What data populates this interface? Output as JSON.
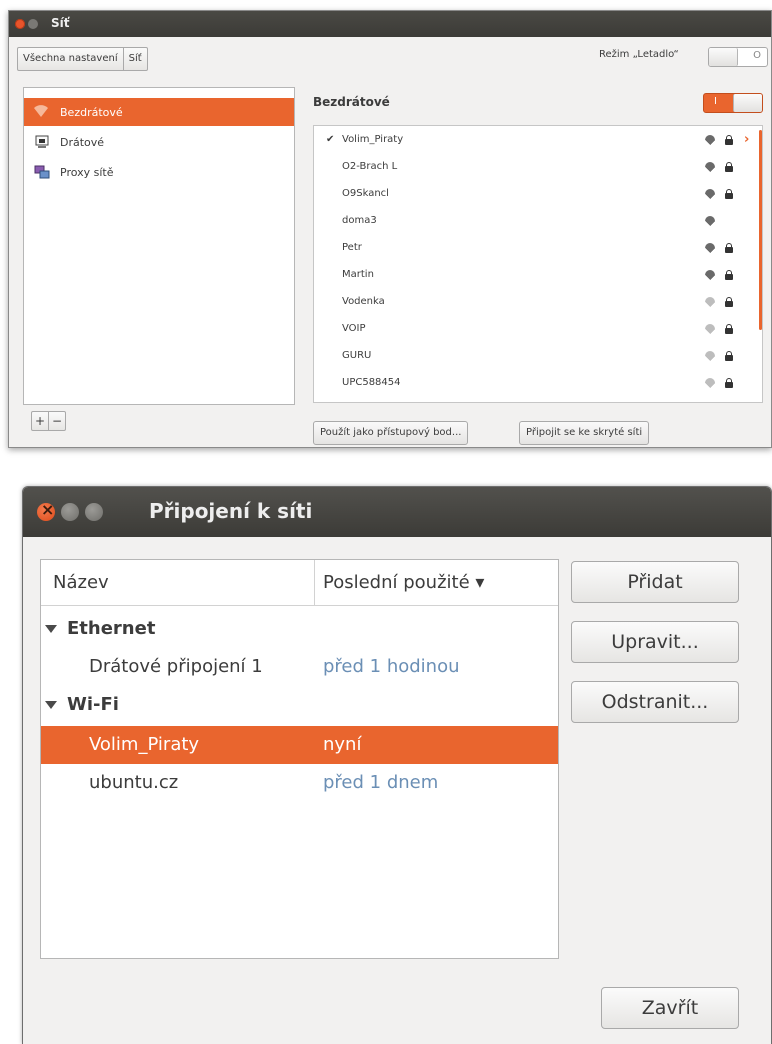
{
  "window_network": {
    "title": "Síť",
    "breadcrumb": [
      "Všechna nastavení",
      "Síť"
    ],
    "airplane_mode_label": "Režim „Letadlo“",
    "airplane_toggle_state": "O",
    "devices": [
      {
        "label": "Bezdrátové",
        "icon": "wifi-icon",
        "selected": true
      },
      {
        "label": "Drátové",
        "icon": "ethernet-icon",
        "selected": false
      },
      {
        "label": "Proxy sítě",
        "icon": "proxy-icon",
        "selected": false
      }
    ],
    "add_label": "+",
    "remove_label": "−",
    "section_title": "Bezdrátové",
    "wireless_toggle_state": "I",
    "networks": [
      {
        "name": "Volim_Piraty",
        "connected": true,
        "check": "✔",
        "locked": true,
        "signal": "strong"
      },
      {
        "name": "O2-Brach L",
        "connected": false,
        "check": "",
        "locked": true,
        "signal": "strong"
      },
      {
        "name": "O9Skancl",
        "connected": false,
        "check": "",
        "locked": true,
        "signal": "strong"
      },
      {
        "name": "doma3",
        "connected": false,
        "check": "",
        "locked": false,
        "signal": "strong"
      },
      {
        "name": "Petr",
        "connected": false,
        "check": "",
        "locked": true,
        "signal": "strong"
      },
      {
        "name": "Martin",
        "connected": false,
        "check": "",
        "locked": true,
        "signal": "strong"
      },
      {
        "name": "Vodenka",
        "connected": false,
        "check": "",
        "locked": true,
        "signal": "weak"
      },
      {
        "name": "VOIP",
        "connected": false,
        "check": "",
        "locked": true,
        "signal": "weak"
      },
      {
        "name": "GURU",
        "connected": false,
        "check": "",
        "locked": true,
        "signal": "weak"
      },
      {
        "name": "UPC588454",
        "connected": false,
        "check": "",
        "locked": true,
        "signal": "weak"
      }
    ],
    "detail_arrow": "›",
    "hotspot_button": "Použít jako přístupový bod...",
    "hidden_button": "Připojit se ke skryté síti",
    "accent_color": "#e9652e"
  },
  "window_connections": {
    "title": "Připojení k síti",
    "columns": {
      "name": "Název",
      "last_used": "Poslední použité ▾"
    },
    "groups": [
      {
        "label": "Ethernet",
        "items": [
          {
            "name": "Drátové připojení 1",
            "last_used": "před 1 hodinou",
            "selected": false
          }
        ]
      },
      {
        "label": "Wi-Fi",
        "items": [
          {
            "name": "Volim_Piraty",
            "last_used": "nyní",
            "selected": true
          },
          {
            "name": "ubuntu.cz",
            "last_used": "před 1 dnem",
            "selected": false
          }
        ]
      }
    ],
    "buttons": {
      "add": "Přidat",
      "edit": "Upravit...",
      "remove": "Odstranit...",
      "close": "Zavřít"
    }
  }
}
